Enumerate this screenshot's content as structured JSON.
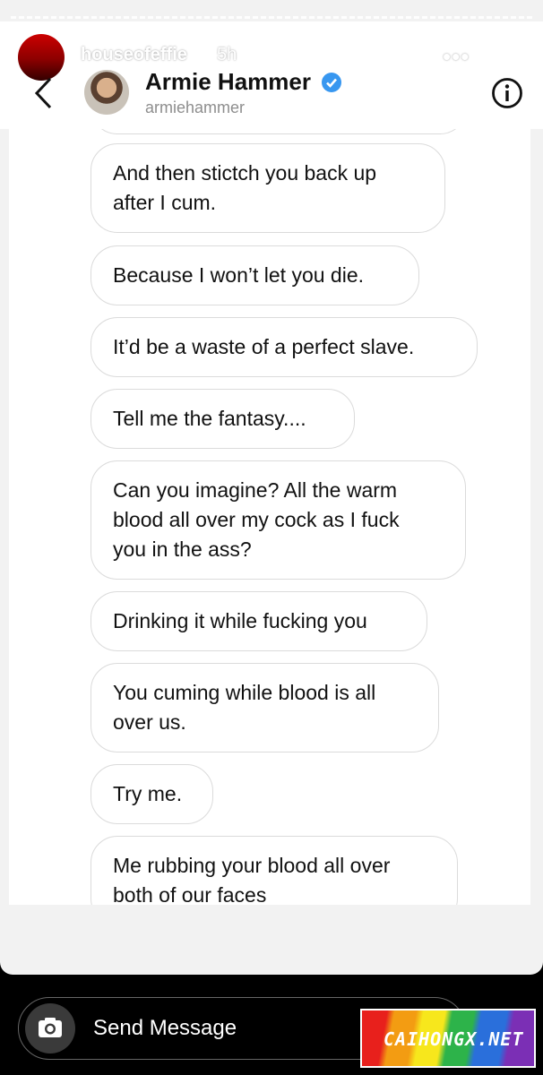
{
  "story": {
    "username": "houseofeffie",
    "time": "5h",
    "more_glyph": "•••"
  },
  "dm": {
    "name": "Armie Hammer",
    "handle": "armiehammer",
    "verified_color": "#3897f0"
  },
  "messages": [
    {
      "lines": [
        "And then stictch you back up",
        "after I cum."
      ]
    },
    {
      "lines": [
        "Because I won’t let you die."
      ]
    },
    {
      "lines": [
        "It’d be a waste of a perfect slave."
      ]
    },
    {
      "lines": [
        "Tell me the fantasy...."
      ]
    },
    {
      "lines": [
        "Can you imagine? All the warm",
        "blood all over my cock as I fuck",
        "you in the ass?"
      ]
    },
    {
      "lines": [
        "Drinking it while fucking you"
      ]
    },
    {
      "lines": [
        "You cuming while blood is all",
        "over us."
      ]
    },
    {
      "lines": [
        "Try me."
      ]
    },
    {
      "lines": [
        "Me rubbing your blood all over",
        "both of our faces"
      ]
    }
  ],
  "send_bar": {
    "placeholder": "Send Message"
  },
  "watermark": {
    "text": "CAIHONGX.NET"
  },
  "icons": {
    "back": "chevron-left-icon",
    "info": "info-icon",
    "close": "close-icon",
    "camera": "camera-icon",
    "verified": "verified-badge-icon"
  }
}
